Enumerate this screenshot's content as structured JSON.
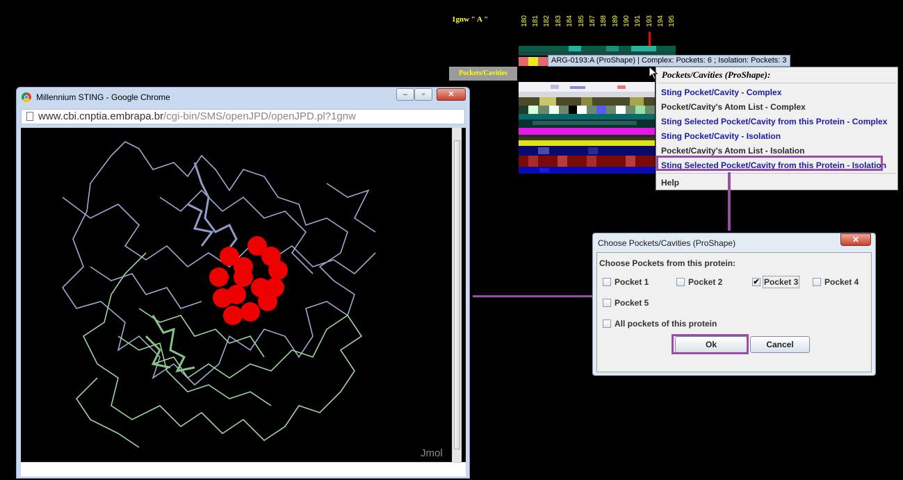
{
  "sequence_view": {
    "protein_label": "1gnw \" A \"",
    "residue_numbers": [
      "180",
      "181",
      "182",
      "183",
      "184",
      "185",
      "187",
      "188",
      "189",
      "190",
      "191",
      "193",
      "194",
      "195"
    ],
    "pockets_label": "Pockets/Cavities"
  },
  "tooltip": {
    "text": "ARG-0193:A (ProShape) | Complex: Pockets: 6 ;  Isolation: Pockets: 3"
  },
  "context_menu": {
    "title": "Pockets/Cavities (ProShape):",
    "items": [
      {
        "label": "Sting Pocket/Cavity - Complex"
      },
      {
        "label": "Pocket/Cavity's Atom List - Complex"
      },
      {
        "label": "Sting Selected Pocket/Cavity from this Protein - Complex"
      },
      {
        "label": "Sting Pocket/Cavity - Isolation"
      },
      {
        "label": "Pocket/Cavity's Atom List - Isolation"
      },
      {
        "label": "Sting Selected Pocket/Cavity from this Protein - Isolation"
      },
      {
        "label": "Help"
      }
    ]
  },
  "browser_window": {
    "title": "Millennium STING - Google Chrome",
    "url_host": "www.cbi.cnptia.embrapa.br",
    "url_path": "/cgi-bin/SMS/openJPD/openJPD.pl?1gnw",
    "viewer_label": "Jmol"
  },
  "dialog": {
    "title": "Choose Pockets/Cavities (ProShape)",
    "prompt": "Choose Pockets from this protein:",
    "checkboxes": [
      {
        "label": "Pocket 1",
        "checked": false
      },
      {
        "label": "Pocket 2",
        "checked": false
      },
      {
        "label": "Pocket 3",
        "checked": true
      },
      {
        "label": "Pocket 4",
        "checked": false
      },
      {
        "label": "Pocket 5",
        "checked": false
      },
      {
        "label": "All pockets of this protein",
        "checked": false
      }
    ],
    "ok_label": "Ok",
    "cancel_label": "Cancel"
  },
  "colors": {
    "highlight": "#9a4da4",
    "menu_link": "#1c1ca8",
    "chain_blue": "#9ea9cf",
    "chain_green": "#9fd49f",
    "pocket_red": "#ff0000"
  }
}
